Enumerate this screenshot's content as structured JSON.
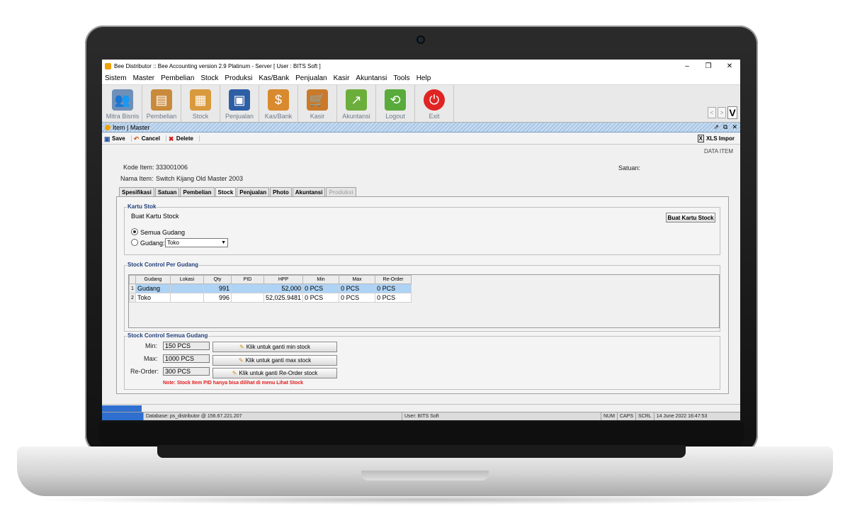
{
  "window": {
    "title": "Bee Distributor :: Bee Accounting version 2.9 Platinum - Server  [ User : BITS Soft ]",
    "controls": [
      "–",
      "❐",
      "✕"
    ]
  },
  "menu": [
    "Sistem",
    "Master",
    "Pembelian",
    "Stock",
    "Produksi",
    "Kas/Bank",
    "Penjualan",
    "Kasir",
    "Akuntansi",
    "Tools",
    "Help"
  ],
  "toolbar": [
    {
      "label": "Mitra Bisnis",
      "icon": "people-icon",
      "color": "#6d8fb8"
    },
    {
      "label": "Pembelian",
      "icon": "document-stack-icon",
      "color": "#c98b3b"
    },
    {
      "label": "Stock",
      "icon": "boxes-icon",
      "color": "#d99a3e"
    },
    {
      "label": "Penjualan",
      "icon": "shopping-bag-icon",
      "color": "#2e5fa5"
    },
    {
      "label": "Kas/Bank",
      "icon": "money-bag-icon",
      "color": "#d98a2e"
    },
    {
      "label": "Kasir",
      "icon": "cart-icon",
      "color": "#c97b2b"
    },
    {
      "label": "Akuntansi",
      "icon": "chart-up-icon",
      "color": "#6cae3c"
    },
    {
      "label": "Logout",
      "icon": "logout-icon",
      "color": "#59ab3b"
    },
    {
      "label": "Exit",
      "icon": "power-icon",
      "color": "#e02424"
    }
  ],
  "nav": {
    "prev": "<",
    "next": ">",
    "v": "V"
  },
  "child": {
    "title": "Item | Master",
    "btns": [
      "⇗",
      "⧉",
      "✕"
    ]
  },
  "actions": {
    "save": "Save",
    "cancel": "Cancel",
    "delete": "Delete",
    "xls": "XLS Impor"
  },
  "data_item": "DATA ITEM",
  "item": {
    "kode_label": "Kode Item:",
    "kode_value": "333001006",
    "nama_label": "Nama Item:",
    "nama_value": "Switch Kijang Old Master 2003",
    "satuan_label": "Satuan:"
  },
  "tabs": [
    {
      "label": "Spesifikasi",
      "state": "normal"
    },
    {
      "label": "Satuan",
      "state": "normal"
    },
    {
      "label": "Pembelian",
      "state": "normal"
    },
    {
      "label": "Stock",
      "state": "active"
    },
    {
      "label": "Penjualan",
      "state": "normal"
    },
    {
      "label": "Photo",
      "state": "normal"
    },
    {
      "label": "Akuntansi",
      "state": "normal"
    },
    {
      "label": "Produksi",
      "state": "disabled"
    }
  ],
  "kartu_stok": {
    "title": "Kartu Stok",
    "buat_label": "Buat Kartu Stock",
    "buat_button": "Buat Kartu Stock",
    "semua_gudang": "Semua Gudang",
    "gudang_label": "Gudang:",
    "gudang_value": "Toko"
  },
  "stock_control": {
    "title": "Stock Control Per Gudang",
    "headers": [
      "Gudang",
      "Lokasi",
      "Qty",
      "PID",
      "HPP",
      "Min",
      "Max",
      "Re-Order"
    ],
    "rows": [
      {
        "num": "1",
        "gudang": "Gudang",
        "lokasi": "",
        "qty": "991",
        "pid": "",
        "hpp": "52,000",
        "min": "0 PCS",
        "max": "0 PCS",
        "reorder": "0 PCS"
      },
      {
        "num": "2",
        "gudang": "Toko",
        "lokasi": "",
        "qty": "996",
        "pid": "",
        "hpp": "52,025.9481",
        "min": "0 PCS",
        "max": "0 PCS",
        "reorder": "0 PCS"
      }
    ]
  },
  "semua_gudang": {
    "title": "Stock Control Semua Gudang",
    "min_label": "Min:",
    "min_value": "150 PCS",
    "min_btn": "Klik untuk ganti min stock",
    "max_label": "Max:",
    "max_value": "1000 PCS",
    "max_btn": "Klik untuk ganti max stock",
    "reorder_label": "Re-Order:",
    "reorder_value": "300 PCS",
    "reorder_btn": "Klik untuk ganti Re-Order stock",
    "note": "Note: Stock Item PID hanya bisa dilihat di menu Lihat Stock"
  },
  "status": {
    "database": "Database: ps_distributor @ 156.67.221.207",
    "user": "User: BITS Soft",
    "num": "NUM",
    "caps": "CAPS",
    "scrl": "SCRL",
    "datetime": "14 June 2022   16:47:53"
  }
}
